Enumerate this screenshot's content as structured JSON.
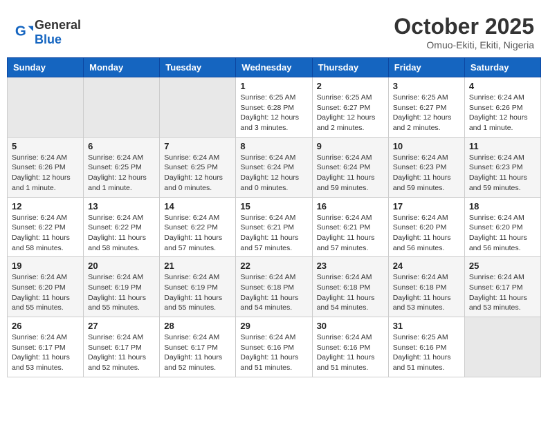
{
  "header": {
    "logo_general": "General",
    "logo_blue": "Blue",
    "month_title": "October 2025",
    "location": "Omuo-Ekiti, Ekiti, Nigeria"
  },
  "weekdays": [
    "Sunday",
    "Monday",
    "Tuesday",
    "Wednesday",
    "Thursday",
    "Friday",
    "Saturday"
  ],
  "weeks": [
    [
      {
        "day": "",
        "info": ""
      },
      {
        "day": "",
        "info": ""
      },
      {
        "day": "",
        "info": ""
      },
      {
        "day": "1",
        "info": "Sunrise: 6:25 AM\nSunset: 6:28 PM\nDaylight: 12 hours and 3 minutes."
      },
      {
        "day": "2",
        "info": "Sunrise: 6:25 AM\nSunset: 6:27 PM\nDaylight: 12 hours and 2 minutes."
      },
      {
        "day": "3",
        "info": "Sunrise: 6:25 AM\nSunset: 6:27 PM\nDaylight: 12 hours and 2 minutes."
      },
      {
        "day": "4",
        "info": "Sunrise: 6:24 AM\nSunset: 6:26 PM\nDaylight: 12 hours and 1 minute."
      }
    ],
    [
      {
        "day": "5",
        "info": "Sunrise: 6:24 AM\nSunset: 6:26 PM\nDaylight: 12 hours and 1 minute."
      },
      {
        "day": "6",
        "info": "Sunrise: 6:24 AM\nSunset: 6:25 PM\nDaylight: 12 hours and 1 minute."
      },
      {
        "day": "7",
        "info": "Sunrise: 6:24 AM\nSunset: 6:25 PM\nDaylight: 12 hours and 0 minutes."
      },
      {
        "day": "8",
        "info": "Sunrise: 6:24 AM\nSunset: 6:24 PM\nDaylight: 12 hours and 0 minutes."
      },
      {
        "day": "9",
        "info": "Sunrise: 6:24 AM\nSunset: 6:24 PM\nDaylight: 11 hours and 59 minutes."
      },
      {
        "day": "10",
        "info": "Sunrise: 6:24 AM\nSunset: 6:23 PM\nDaylight: 11 hours and 59 minutes."
      },
      {
        "day": "11",
        "info": "Sunrise: 6:24 AM\nSunset: 6:23 PM\nDaylight: 11 hours and 59 minutes."
      }
    ],
    [
      {
        "day": "12",
        "info": "Sunrise: 6:24 AM\nSunset: 6:22 PM\nDaylight: 11 hours and 58 minutes."
      },
      {
        "day": "13",
        "info": "Sunrise: 6:24 AM\nSunset: 6:22 PM\nDaylight: 11 hours and 58 minutes."
      },
      {
        "day": "14",
        "info": "Sunrise: 6:24 AM\nSunset: 6:22 PM\nDaylight: 11 hours and 57 minutes."
      },
      {
        "day": "15",
        "info": "Sunrise: 6:24 AM\nSunset: 6:21 PM\nDaylight: 11 hours and 57 minutes."
      },
      {
        "day": "16",
        "info": "Sunrise: 6:24 AM\nSunset: 6:21 PM\nDaylight: 11 hours and 57 minutes."
      },
      {
        "day": "17",
        "info": "Sunrise: 6:24 AM\nSunset: 6:20 PM\nDaylight: 11 hours and 56 minutes."
      },
      {
        "day": "18",
        "info": "Sunrise: 6:24 AM\nSunset: 6:20 PM\nDaylight: 11 hours and 56 minutes."
      }
    ],
    [
      {
        "day": "19",
        "info": "Sunrise: 6:24 AM\nSunset: 6:20 PM\nDaylight: 11 hours and 55 minutes."
      },
      {
        "day": "20",
        "info": "Sunrise: 6:24 AM\nSunset: 6:19 PM\nDaylight: 11 hours and 55 minutes."
      },
      {
        "day": "21",
        "info": "Sunrise: 6:24 AM\nSunset: 6:19 PM\nDaylight: 11 hours and 55 minutes."
      },
      {
        "day": "22",
        "info": "Sunrise: 6:24 AM\nSunset: 6:18 PM\nDaylight: 11 hours and 54 minutes."
      },
      {
        "day": "23",
        "info": "Sunrise: 6:24 AM\nSunset: 6:18 PM\nDaylight: 11 hours and 54 minutes."
      },
      {
        "day": "24",
        "info": "Sunrise: 6:24 AM\nSunset: 6:18 PM\nDaylight: 11 hours and 53 minutes."
      },
      {
        "day": "25",
        "info": "Sunrise: 6:24 AM\nSunset: 6:17 PM\nDaylight: 11 hours and 53 minutes."
      }
    ],
    [
      {
        "day": "26",
        "info": "Sunrise: 6:24 AM\nSunset: 6:17 PM\nDaylight: 11 hours and 53 minutes."
      },
      {
        "day": "27",
        "info": "Sunrise: 6:24 AM\nSunset: 6:17 PM\nDaylight: 11 hours and 52 minutes."
      },
      {
        "day": "28",
        "info": "Sunrise: 6:24 AM\nSunset: 6:17 PM\nDaylight: 11 hours and 52 minutes."
      },
      {
        "day": "29",
        "info": "Sunrise: 6:24 AM\nSunset: 6:16 PM\nDaylight: 11 hours and 51 minutes."
      },
      {
        "day": "30",
        "info": "Sunrise: 6:24 AM\nSunset: 6:16 PM\nDaylight: 11 hours and 51 minutes."
      },
      {
        "day": "31",
        "info": "Sunrise: 6:25 AM\nSunset: 6:16 PM\nDaylight: 11 hours and 51 minutes."
      },
      {
        "day": "",
        "info": ""
      }
    ]
  ]
}
